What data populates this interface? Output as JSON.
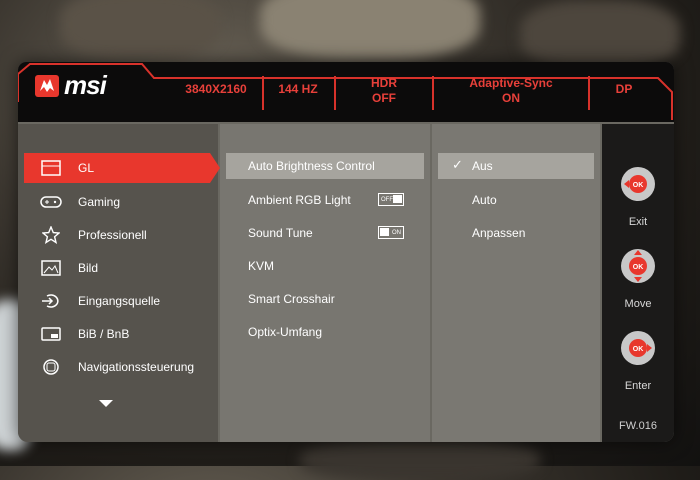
{
  "brand": {
    "name": "msi"
  },
  "header": {
    "resolution": "3840X2160",
    "refresh": "144 HZ",
    "hdr_label": "HDR",
    "hdr_value": "OFF",
    "sync_label": "Adaptive-Sync",
    "sync_value": "ON",
    "input": "DP"
  },
  "sidebar": {
    "items": [
      {
        "label": "GL",
        "icon": "panel-icon",
        "active": true
      },
      {
        "label": "Gaming",
        "icon": "gamepad-icon"
      },
      {
        "label": "Professionell",
        "icon": "star-icon"
      },
      {
        "label": "Bild",
        "icon": "image-icon"
      },
      {
        "label": "Eingangsquelle",
        "icon": "input-source-icon"
      },
      {
        "label": "BiB / BnB",
        "icon": "pip-icon"
      },
      {
        "label": "Navigationssteuerung",
        "icon": "navigation-icon"
      }
    ],
    "more_icon": "chevron-down-icon"
  },
  "submenu": {
    "items": [
      {
        "label": "Auto Brightness Control",
        "selected": true
      },
      {
        "label": "Ambient RGB Light",
        "toggle": "OFF"
      },
      {
        "label": "Sound Tune",
        "toggle": "ON"
      },
      {
        "label": "KVM"
      },
      {
        "label": "Smart Crosshair"
      },
      {
        "label": "Optix-Umfang"
      }
    ]
  },
  "options": {
    "items": [
      {
        "label": "Aus",
        "checked": true
      },
      {
        "label": "Auto"
      },
      {
        "label": "Anpassen"
      }
    ]
  },
  "controls": {
    "exit_label": "Exit",
    "move_label": "Move",
    "enter_label": "Enter",
    "button_center": "OK",
    "firmware": "FW.016"
  },
  "colors": {
    "accent": "#e8372d",
    "header_bg": "#0c0b0b"
  }
}
